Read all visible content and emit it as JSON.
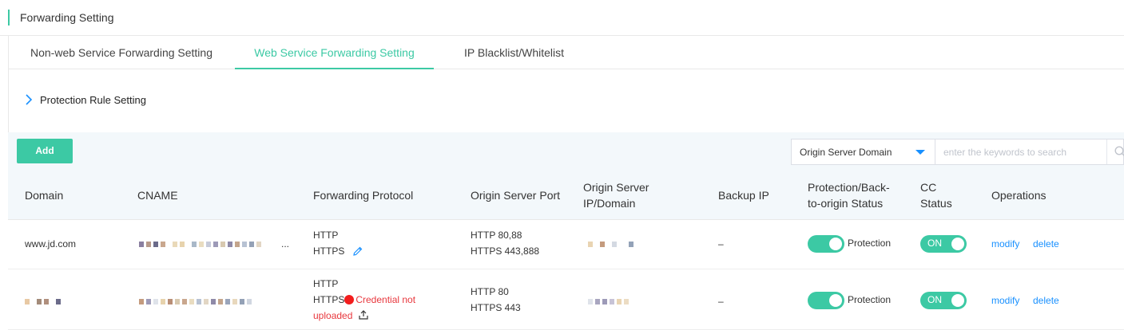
{
  "page": {
    "title": "Forwarding Setting"
  },
  "tabs": [
    {
      "label": "Non-web Service Forwarding Setting"
    },
    {
      "label": "Web Service Forwarding Setting",
      "active": true
    },
    {
      "label": "IP Blacklist/Whitelist"
    }
  ],
  "section": {
    "label": "Protection Rule Setting"
  },
  "toolbar": {
    "add_label": "Add",
    "filter_selected": "Origin Server Domain",
    "search_placeholder": "enter the keywords to search"
  },
  "table": {
    "headers": {
      "domain": "Domain",
      "cname": "CNAME",
      "protocol": "Forwarding Protocol",
      "port": "Origin Server Port",
      "origin_line1": "Origin Server",
      "origin_line2": "IP/Domain",
      "backup": "Backup IP",
      "status_line1": "Protection/Back-",
      "status_line2": "to-origin Status",
      "cc_line1": "CC",
      "cc_line2": "Status",
      "ops": "Operations"
    },
    "rows": [
      {
        "domain": "www.jd.com",
        "cname_suffix": "...",
        "protocol_1": "HTTP",
        "protocol_2": "HTTPS",
        "port_1": "HTTP 80,88",
        "port_2": "HTTPS 443,888",
        "backup": "–",
        "protection_label": "Protection",
        "cc_label": "ON",
        "modify": "modify",
        "delete": "delete"
      },
      {
        "protocol_1": "HTTP",
        "protocol_2": "HTTPS",
        "credential_1": "Credential not",
        "credential_2": "uploaded",
        "port_1": "HTTP 80",
        "port_2": "HTTPS 443",
        "backup": "–",
        "protection_label": "Protection",
        "cc_label": "ON",
        "modify": "modify",
        "delete": "delete"
      }
    ]
  },
  "colors": {
    "accent": "#3cc9a4",
    "link": "#1890ff",
    "error": "#e8373d"
  },
  "icons": [
    "chevron-right-icon",
    "caret-down-icon",
    "search-icon",
    "edit-pencil-icon",
    "error-dot-icon",
    "upload-icon"
  ]
}
